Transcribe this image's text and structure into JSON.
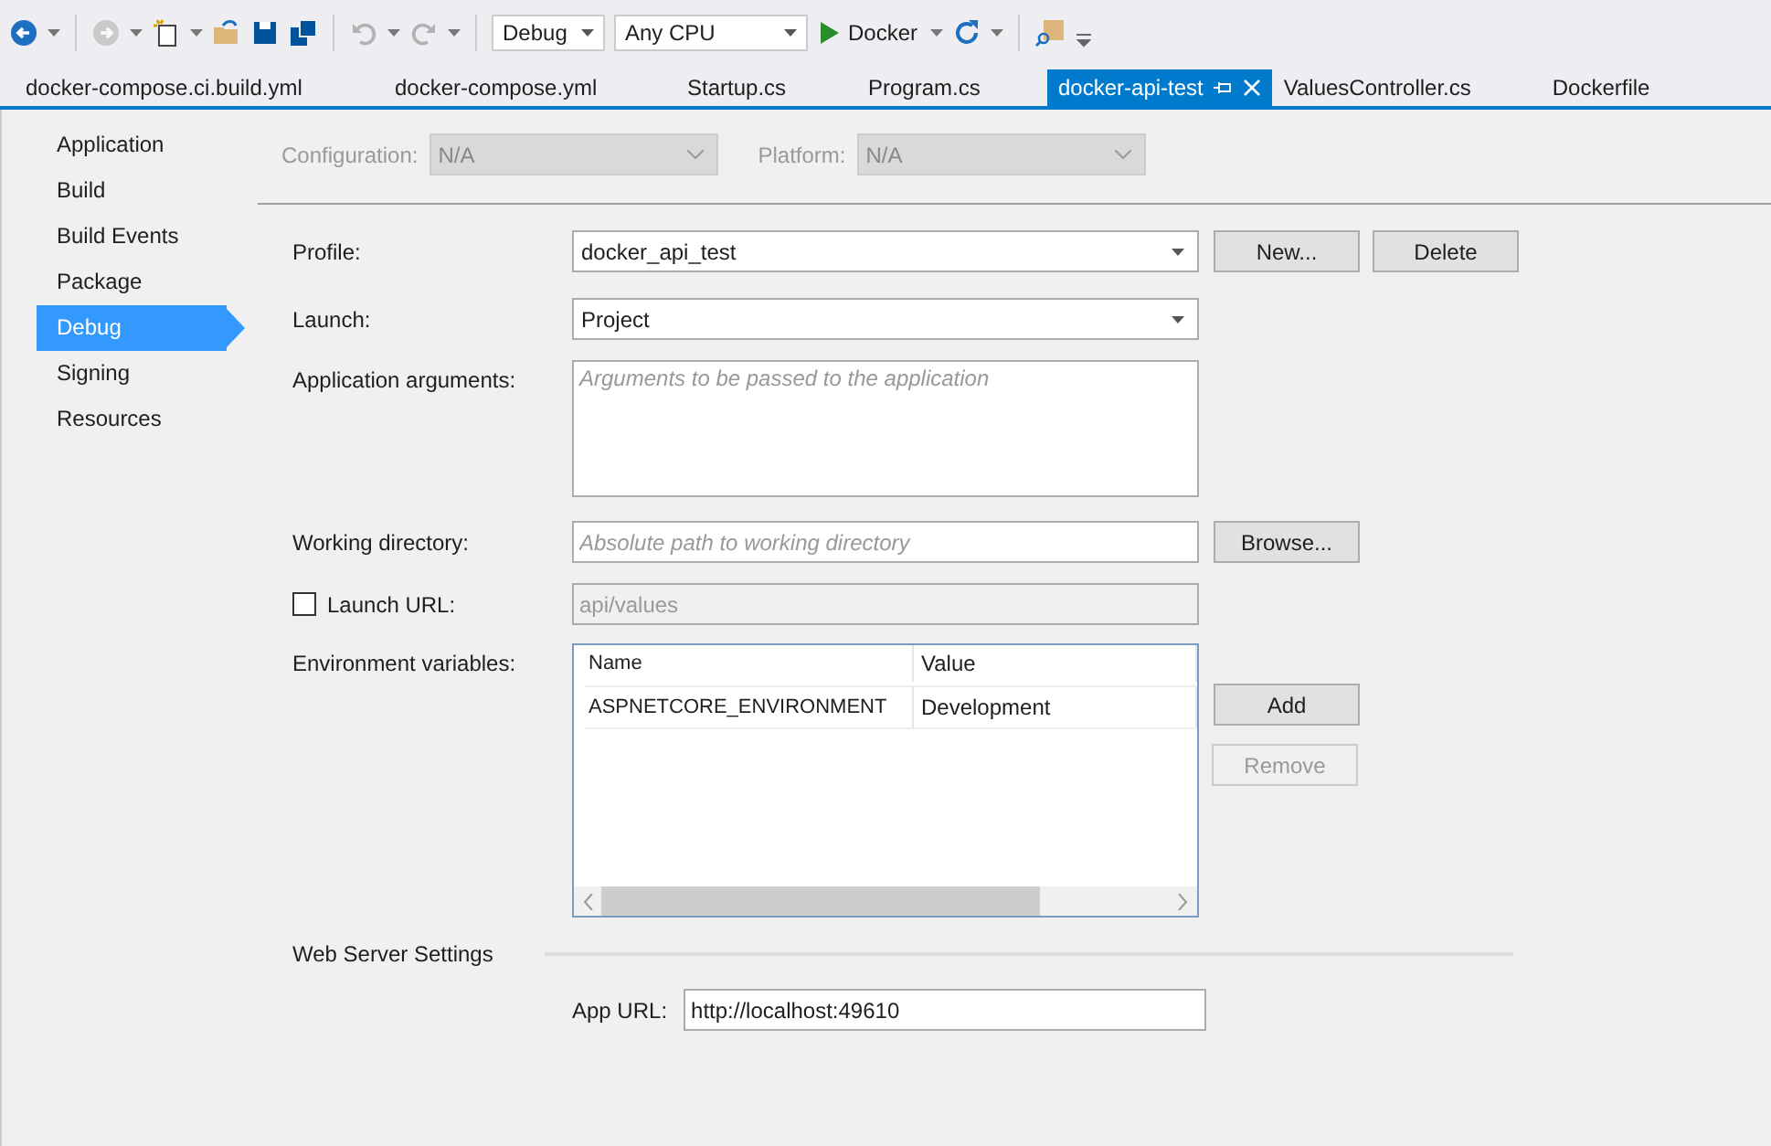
{
  "toolbar": {
    "buttons": [
      {
        "kind": "back",
        "disabled": false
      },
      {
        "kind": "forward",
        "disabled": true
      },
      {
        "kind": "new",
        "disabled": false
      },
      {
        "kind": "open",
        "disabled": false
      },
      {
        "kind": "save",
        "disabled": false
      },
      {
        "kind": "saveall",
        "disabled": false
      },
      {
        "kind": "undo",
        "disabled": true
      },
      {
        "kind": "redo",
        "disabled": true
      }
    ],
    "configuration": "Debug",
    "platform": "Any CPU",
    "run": "Docker"
  },
  "tabs": [
    {
      "label": "docker-compose.ci.build.yml",
      "selected": false
    },
    {
      "label": "docker-compose.yml",
      "selected": false
    },
    {
      "label": "Startup.cs",
      "selected": false
    },
    {
      "label": "Program.cs",
      "selected": false
    },
    {
      "label": "docker-api-test",
      "selected": true
    },
    {
      "label": "ValuesController.cs",
      "selected": false
    },
    {
      "label": "Dockerfile",
      "selected": false
    }
  ],
  "sidebar": {
    "items": [
      {
        "label": "Application",
        "selected": false
      },
      {
        "label": "Build",
        "selected": false
      },
      {
        "label": "Build Events",
        "selected": false
      },
      {
        "label": "Package",
        "selected": false
      },
      {
        "label": "Debug",
        "selected": true
      },
      {
        "label": "Signing",
        "selected": false
      },
      {
        "label": "Resources",
        "selected": false
      }
    ]
  },
  "header": {
    "configuration_label": "Configuration:",
    "configuration": "N/A",
    "platform_label": "Platform:",
    "platform": "N/A",
    "disabled": true
  },
  "profile": {
    "label": "Profile:",
    "value": "docker_api_test",
    "buttons": [
      {
        "label": "New...",
        "disabled": false
      },
      {
        "label": "Delete",
        "disabled": false
      }
    ]
  },
  "launch": {
    "label": "Launch:",
    "value": "Project"
  },
  "arguments": {
    "label": "Application arguments:",
    "placeholder": "Arguments to be passed to the application"
  },
  "working_directory": {
    "label": "Working directory:",
    "placeholder": "Absolute path to working directory",
    "button": "Browse..."
  },
  "launch_url": {
    "label": "Launch URL:",
    "checked": false,
    "value": "api/values"
  },
  "environment": {
    "label": "Environment variables:",
    "columns": [
      "Name",
      "Value"
    ],
    "rows": [
      [
        "ASPNETCORE_ENVIRONMENT",
        "Development"
      ]
    ],
    "buttons": [
      {
        "label": "Add",
        "disabled": false
      },
      {
        "label": "Remove",
        "disabled": true
      }
    ]
  },
  "web_server": {
    "title": "Web Server Settings",
    "app_url_label": "App URL:",
    "app_url": "http://localhost:49610"
  }
}
